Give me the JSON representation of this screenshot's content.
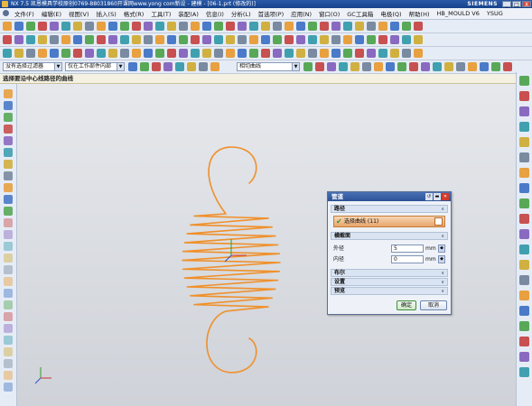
{
  "window": {
    "title": "NX 7.5 凯恩模具学校原创0769-88031860开课网www.yong com新设 - 建模 - [06-1.prt (修改的)]",
    "brand": "SIEMENS",
    "buttons": {
      "minimize": "_",
      "maximize": "□",
      "close": "X"
    }
  },
  "menu": [
    "文件(F)",
    "编辑(E)",
    "视图(V)",
    "插入(S)",
    "格式(R)",
    "工具(T)",
    "装配(A)",
    "信息(I)",
    "分析(L)",
    "首选项(P)",
    "应用(N)",
    "窗口(O)",
    "GC工具箱",
    "电极(Q)",
    "帮助(H)",
    "HB_MOULD V6",
    "YSUG"
  ],
  "selection_bar": {
    "filter": "没有选择过滤器",
    "scope": "仅在工作部件内部",
    "curve_rule": "相切曲线"
  },
  "cue_line": "选择要沿中心线路径的曲线",
  "dialog": {
    "title": "管道",
    "section_path": "路径",
    "select_curve": "选择曲线 (11)",
    "section_cross": "横截面",
    "outer_label": "外径",
    "outer_value": "5",
    "outer_unit": "mm",
    "inner_label": "内径",
    "inner_value": "0",
    "inner_unit": "mm",
    "section_boolean": "布尔",
    "section_settings": "设置",
    "section_preview": "预览",
    "ok_label": "确定",
    "cancel_label": "取消",
    "expand_glyph": "∧",
    "collapse_glyph": "∨"
  },
  "colors": {
    "spring": "#f0902a",
    "titlebar": "#1f4d9a",
    "viewport": "#d8dbe0"
  }
}
